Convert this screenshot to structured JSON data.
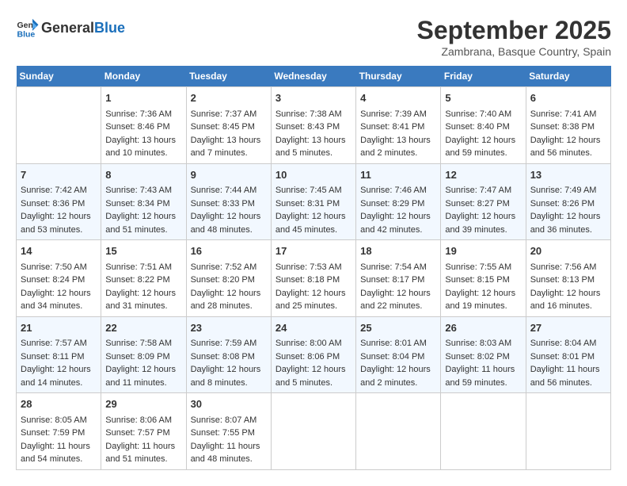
{
  "header": {
    "logo_general": "General",
    "logo_blue": "Blue",
    "title": "September 2025",
    "subtitle": "Zambrana, Basque Country, Spain"
  },
  "days_of_week": [
    "Sunday",
    "Monday",
    "Tuesday",
    "Wednesday",
    "Thursday",
    "Friday",
    "Saturday"
  ],
  "weeks": [
    [
      {
        "day": "",
        "info": ""
      },
      {
        "day": "1",
        "info": "Sunrise: 7:36 AM\nSunset: 8:46 PM\nDaylight: 13 hours\nand 10 minutes."
      },
      {
        "day": "2",
        "info": "Sunrise: 7:37 AM\nSunset: 8:45 PM\nDaylight: 13 hours\nand 7 minutes."
      },
      {
        "day": "3",
        "info": "Sunrise: 7:38 AM\nSunset: 8:43 PM\nDaylight: 13 hours\nand 5 minutes."
      },
      {
        "day": "4",
        "info": "Sunrise: 7:39 AM\nSunset: 8:41 PM\nDaylight: 13 hours\nand 2 minutes."
      },
      {
        "day": "5",
        "info": "Sunrise: 7:40 AM\nSunset: 8:40 PM\nDaylight: 12 hours\nand 59 minutes."
      },
      {
        "day": "6",
        "info": "Sunrise: 7:41 AM\nSunset: 8:38 PM\nDaylight: 12 hours\nand 56 minutes."
      }
    ],
    [
      {
        "day": "7",
        "info": "Sunrise: 7:42 AM\nSunset: 8:36 PM\nDaylight: 12 hours\nand 53 minutes."
      },
      {
        "day": "8",
        "info": "Sunrise: 7:43 AM\nSunset: 8:34 PM\nDaylight: 12 hours\nand 51 minutes."
      },
      {
        "day": "9",
        "info": "Sunrise: 7:44 AM\nSunset: 8:33 PM\nDaylight: 12 hours\nand 48 minutes."
      },
      {
        "day": "10",
        "info": "Sunrise: 7:45 AM\nSunset: 8:31 PM\nDaylight: 12 hours\nand 45 minutes."
      },
      {
        "day": "11",
        "info": "Sunrise: 7:46 AM\nSunset: 8:29 PM\nDaylight: 12 hours\nand 42 minutes."
      },
      {
        "day": "12",
        "info": "Sunrise: 7:47 AM\nSunset: 8:27 PM\nDaylight: 12 hours\nand 39 minutes."
      },
      {
        "day": "13",
        "info": "Sunrise: 7:49 AM\nSunset: 8:26 PM\nDaylight: 12 hours\nand 36 minutes."
      }
    ],
    [
      {
        "day": "14",
        "info": "Sunrise: 7:50 AM\nSunset: 8:24 PM\nDaylight: 12 hours\nand 34 minutes."
      },
      {
        "day": "15",
        "info": "Sunrise: 7:51 AM\nSunset: 8:22 PM\nDaylight: 12 hours\nand 31 minutes."
      },
      {
        "day": "16",
        "info": "Sunrise: 7:52 AM\nSunset: 8:20 PM\nDaylight: 12 hours\nand 28 minutes."
      },
      {
        "day": "17",
        "info": "Sunrise: 7:53 AM\nSunset: 8:18 PM\nDaylight: 12 hours\nand 25 minutes."
      },
      {
        "day": "18",
        "info": "Sunrise: 7:54 AM\nSunset: 8:17 PM\nDaylight: 12 hours\nand 22 minutes."
      },
      {
        "day": "19",
        "info": "Sunrise: 7:55 AM\nSunset: 8:15 PM\nDaylight: 12 hours\nand 19 minutes."
      },
      {
        "day": "20",
        "info": "Sunrise: 7:56 AM\nSunset: 8:13 PM\nDaylight: 12 hours\nand 16 minutes."
      }
    ],
    [
      {
        "day": "21",
        "info": "Sunrise: 7:57 AM\nSunset: 8:11 PM\nDaylight: 12 hours\nand 14 minutes."
      },
      {
        "day": "22",
        "info": "Sunrise: 7:58 AM\nSunset: 8:09 PM\nDaylight: 12 hours\nand 11 minutes."
      },
      {
        "day": "23",
        "info": "Sunrise: 7:59 AM\nSunset: 8:08 PM\nDaylight: 12 hours\nand 8 minutes."
      },
      {
        "day": "24",
        "info": "Sunrise: 8:00 AM\nSunset: 8:06 PM\nDaylight: 12 hours\nand 5 minutes."
      },
      {
        "day": "25",
        "info": "Sunrise: 8:01 AM\nSunset: 8:04 PM\nDaylight: 12 hours\nand 2 minutes."
      },
      {
        "day": "26",
        "info": "Sunrise: 8:03 AM\nSunset: 8:02 PM\nDaylight: 11 hours\nand 59 minutes."
      },
      {
        "day": "27",
        "info": "Sunrise: 8:04 AM\nSunset: 8:01 PM\nDaylight: 11 hours\nand 56 minutes."
      }
    ],
    [
      {
        "day": "28",
        "info": "Sunrise: 8:05 AM\nSunset: 7:59 PM\nDaylight: 11 hours\nand 54 minutes."
      },
      {
        "day": "29",
        "info": "Sunrise: 8:06 AM\nSunset: 7:57 PM\nDaylight: 11 hours\nand 51 minutes."
      },
      {
        "day": "30",
        "info": "Sunrise: 8:07 AM\nSunset: 7:55 PM\nDaylight: 11 hours\nand 48 minutes."
      },
      {
        "day": "",
        "info": ""
      },
      {
        "day": "",
        "info": ""
      },
      {
        "day": "",
        "info": ""
      },
      {
        "day": "",
        "info": ""
      }
    ]
  ]
}
